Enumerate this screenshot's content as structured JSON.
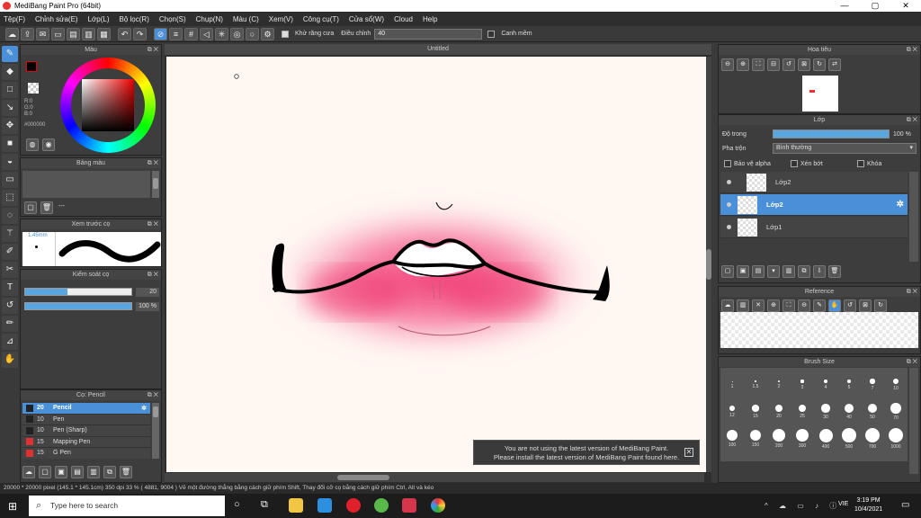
{
  "window": {
    "title": "MediBang Paint Pro (64bit)",
    "minimize": "—",
    "maximize": "▢",
    "close": "✕"
  },
  "menu": [
    "Tệp(F)",
    "Chỉnh sửa(E)",
    "Lớp(L)",
    "Bộ lọc(R)",
    "Chọn(S)",
    "Chụp(N)",
    "Màu (C)",
    "Xem(V)",
    "Công cụ(T)",
    "Cửa sổ(W)",
    "Cloud",
    "Help"
  ],
  "toolbar": {
    "antialias_label": "Khử răng cưa",
    "adjust_label": "Điều chỉnh",
    "adjust_value": "40",
    "snap_label": "Canh mềm"
  },
  "panels": {
    "color": {
      "title": "Màu",
      "r": "R:0",
      "g": "G:0",
      "b": "B:0",
      "hex": "#000000"
    },
    "palette": {
      "title": "Bảng màu",
      "dash": "---"
    },
    "preview": {
      "title": "Xem trước cọ",
      "size": "1.45mm"
    },
    "control": {
      "title": "Kiểm soát cọ",
      "size_value": "20",
      "opacity_value": "100 %",
      "size_fraction": 0.4,
      "opacity_fraction": 1.0
    },
    "brush": {
      "title": "Cọ: Pencil",
      "items": [
        {
          "size": "20",
          "name": "Pencil",
          "color": "#222222",
          "selected": true
        },
        {
          "size": "10",
          "name": "Pen",
          "color": "#222222"
        },
        {
          "size": "10",
          "name": "Pen (Sharp)",
          "color": "#222222"
        },
        {
          "size": "15",
          "name": "Mapping Pen",
          "color": "#e03030"
        },
        {
          "size": "15",
          "name": "G Pen",
          "color": "#e03030"
        }
      ]
    }
  },
  "canvas": {
    "tab": "Untitled"
  },
  "notice": {
    "line1": "You are not using the latest version of MediBang Paint.",
    "line2": "Please install the latest version of MediBang Paint found here."
  },
  "right": {
    "navigator": {
      "title": "Hoa tiêu"
    },
    "layer": {
      "title": "Lớp",
      "opacity_label": "Độ trong",
      "opacity_value": "100 %",
      "blend_label": "Pha trộn",
      "blend_value": "Bình thường",
      "protect_alpha": "Bảo vệ alpha",
      "clipping": "Xén bớt",
      "lock": "Khóa",
      "items": [
        {
          "name": "Lớp2",
          "selected": false
        },
        {
          "name": "Lớp2",
          "selected": true
        },
        {
          "name": "Lớp1",
          "selected": false
        }
      ]
    },
    "reference": {
      "title": "Reference"
    },
    "brushsize": {
      "title": "Brush Size",
      "sizes": [
        "1",
        "1.5",
        "2",
        "3",
        "4",
        "5",
        "7",
        "10",
        "12",
        "15",
        "20",
        "25",
        "30",
        "40",
        "50",
        "70",
        "100",
        "150",
        "200",
        "300",
        "400",
        "500",
        "700",
        "1000"
      ]
    }
  },
  "status": "20000 * 20000 pixel  (145.1 * 145.1cm)  350 dpi  33 %  ( 4881, 9004 )  Vẽ một đường thẳng bằng cách giữ phím Shift, Thay đổi cỡ cọ bằng cách giữ phím Ctrl, Alt và kéo",
  "taskbar": {
    "search_placeholder": "Type here to search",
    "lang": "VIE",
    "time": "3:19 PM",
    "date": "10/4/2021"
  }
}
